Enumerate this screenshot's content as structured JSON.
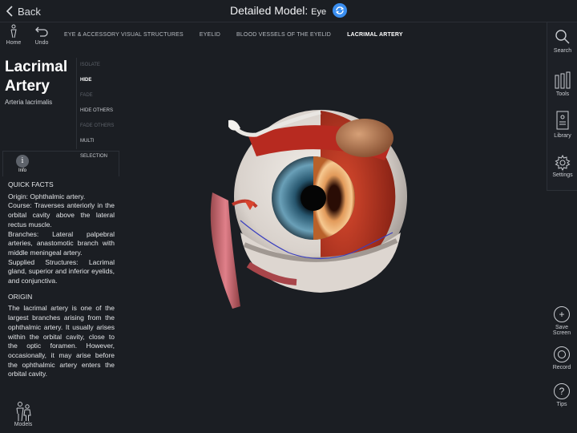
{
  "header": {
    "back_label": "Back",
    "title": "Detailed Model:",
    "subtitle": "Eye"
  },
  "left_tools": {
    "home_label": "Home",
    "undo_label": "Undo"
  },
  "breadcrumb": [
    "EYE & ACCESSORY VISUAL STRUCTURES",
    "EYELID",
    "BLOOD VESSELS OF THE EYELID",
    "LACRIMAL ARTERY"
  ],
  "structure": {
    "name": "Lacrimal Artery",
    "latin": "Arteria lacrimalis"
  },
  "actions": [
    "ISOLATE",
    "HIDE",
    "FADE",
    "HIDE OTHERS",
    "FADE OTHERS",
    "MULTI SELECTION"
  ],
  "info": {
    "icon_glyph": "i",
    "label": "Info"
  },
  "quick_facts": {
    "heading": "QUICK FACTS",
    "origin": "Origin: Ophthalmic artery.",
    "course": "Course: Traverses anteriorly in the orbital cavity above the lateral rectus muscle.",
    "branches": "Branches: Lateral palpebral arteries, anastomotic branch with middle meningeal artery.",
    "supplied": "Supplied Structures: Lacrimal gland, superior and inferior eyelids, and conjunctiva."
  },
  "origin_section": {
    "heading": "ORIGIN",
    "text": "The lacrimal artery is one of the largest branches arising from the ophthalmic artery. It usually arises within the orbital cavity, close to the optic foramen. However, occasionally, it may arise before the ophthalmic artery enters the orbital cavity."
  },
  "bottom_left": {
    "models_label": "Models"
  },
  "right_panel": {
    "search_label": "Search",
    "tools_label": "Tools",
    "library_label": "Library",
    "settings_label": "Settings",
    "save_line1": "Save",
    "save_line2": "Screen",
    "record_label": "Record",
    "tips_label": "Tips",
    "plus_glyph": "+",
    "tips_glyph": "?"
  },
  "colors": {
    "background": "#1b1e23",
    "accent_blue": "#3a8ef0",
    "artery": "#c0392b",
    "gland": "#b8805a"
  }
}
